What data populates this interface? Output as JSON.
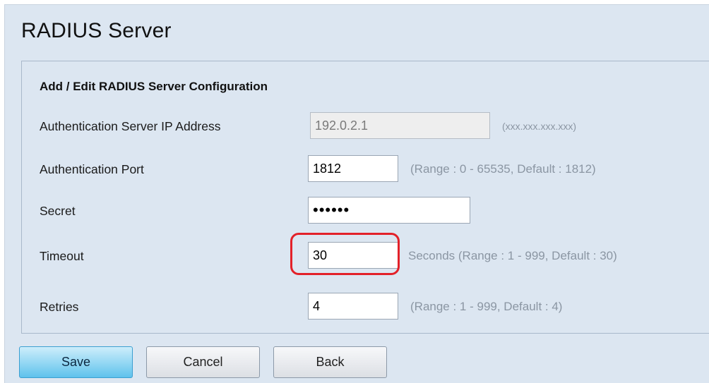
{
  "page": {
    "title": "RADIUS Server"
  },
  "panel": {
    "title": "Add / Edit RADIUS Server Configuration",
    "fields": {
      "ip": {
        "label": "Authentication Server IP Address",
        "value": "192.0.2.1",
        "hint": "(xxx.xxx.xxx.xxx)",
        "disabled": true
      },
      "port": {
        "label": "Authentication Port",
        "value": "1812",
        "hint": "(Range : 0 - 65535, Default : 1812)"
      },
      "secret": {
        "label": "Secret",
        "value": "••••••"
      },
      "timeout": {
        "label": "Timeout",
        "value": "30",
        "hint": "Seconds (Range : 1 - 999, Default : 30)",
        "highlighted": true
      },
      "retries": {
        "label": "Retries",
        "value": "4",
        "hint": "(Range : 1 - 999, Default : 4)"
      }
    }
  },
  "buttons": {
    "save": "Save",
    "cancel": "Cancel",
    "back": "Back"
  },
  "colors": {
    "page_bg": "#dce6f1",
    "highlight": "#e32129",
    "primary_button": "#5fc2ec",
    "hint_text": "#8b96a3"
  }
}
